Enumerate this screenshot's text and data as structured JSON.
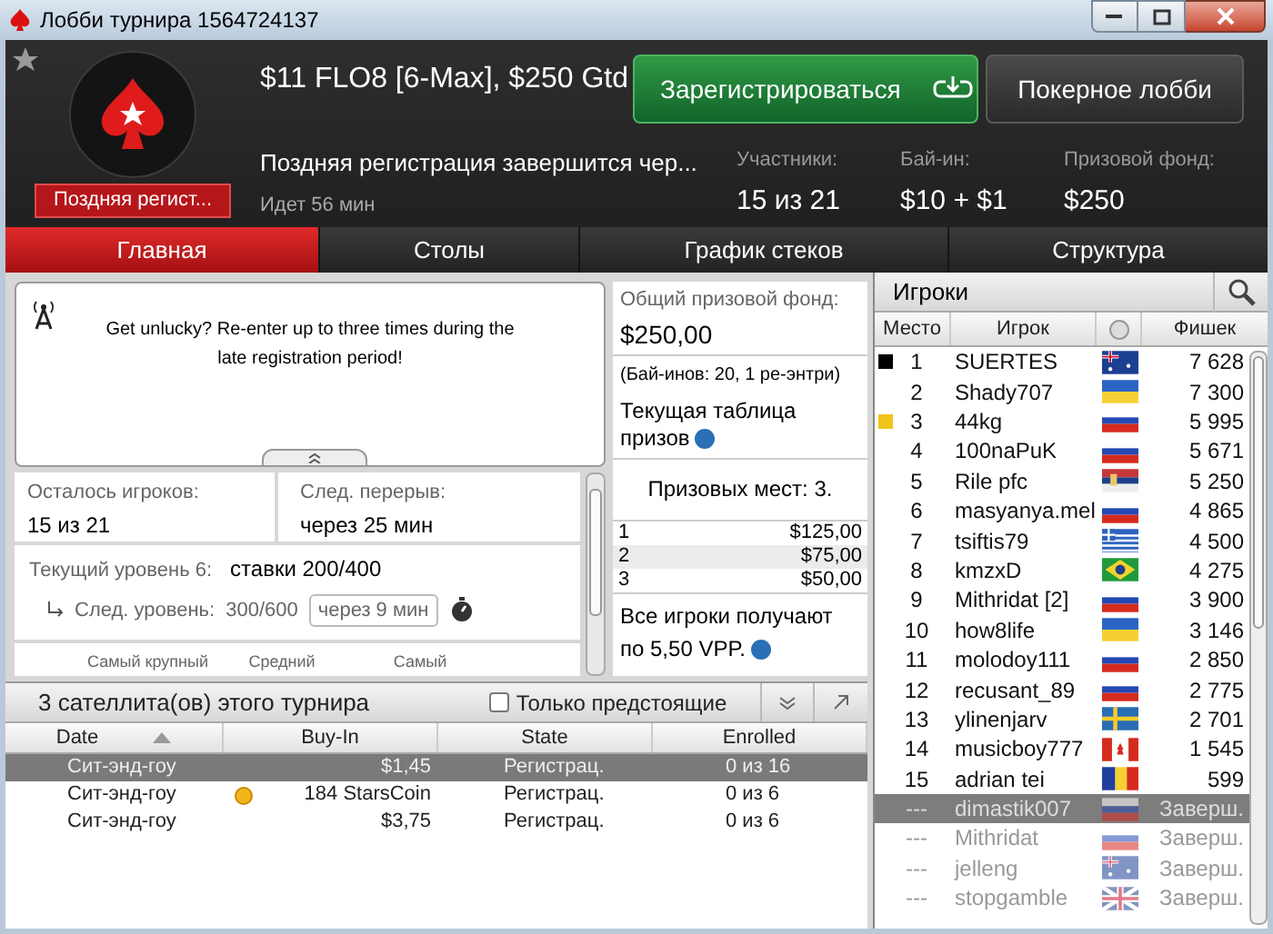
{
  "window": {
    "title": "Лобби турнира 1564724137"
  },
  "header": {
    "tournament_name": "$11 FLO8 [6-Max], $250 Gtd",
    "status_badge": "Поздняя регист...",
    "register_button": "Зарегистрироваться",
    "lobby_button": "Покерное лобби",
    "late_reg_notice": "Поздняя регистрация завершится чер...",
    "elapsed": "Идет 56 мин",
    "stats": [
      {
        "label": "Участники:",
        "value": "15 из 21"
      },
      {
        "label": "Бай-ин:",
        "value": "$10 + $1"
      },
      {
        "label": "Призовой фонд:",
        "value": "$250"
      }
    ]
  },
  "tabs": [
    {
      "label": "Главная",
      "selected": true
    },
    {
      "label": "Столы",
      "selected": false
    },
    {
      "label": "График стеков",
      "selected": false
    },
    {
      "label": "Структура",
      "selected": false
    }
  ],
  "announcement": "Get unlucky? Re-enter up to three times during the late registration period!",
  "info": {
    "players_left": {
      "label": "Осталось игроков:",
      "value": "15 из 21"
    },
    "next_break": {
      "label": "След. перерыв:",
      "value": "через 25 мин"
    },
    "current_level": {
      "label": "Текущий уровень 6:",
      "value": "ставки 200/400"
    },
    "next_level": {
      "label": "След. уровень:",
      "value": "300/600",
      "timer": "через 9 мин"
    },
    "stack_columns": [
      "Самый крупный",
      "Средний",
      "Самый"
    ]
  },
  "prize_pool": {
    "label": "Общий призовой фонд:",
    "amount": "$250,00",
    "entries": "(Бай-инов: 20, 1 ре-энтри)",
    "table_title": "Текущая таблица призов",
    "places": "Призовых мест: 3.",
    "payouts": [
      {
        "place": "1",
        "amount": "$125,00"
      },
      {
        "place": "2",
        "amount": "$75,00"
      },
      {
        "place": "3",
        "amount": "$50,00"
      }
    ],
    "vpp": "Все игроки получают по 5,50 VPP."
  },
  "players": {
    "title": "Игроки",
    "columns": [
      "Место",
      "Игрок",
      "Фишек"
    ],
    "rows": [
      {
        "place": "1",
        "name": "SUERTES",
        "kind": "au",
        "chips": "7 628",
        "color": "#000000",
        "eliminated": false,
        "selected": false
      },
      {
        "place": "2",
        "name": "Shady707",
        "kind": "ua",
        "chips": "7 300",
        "eliminated": false,
        "selected": false
      },
      {
        "place": "3",
        "name": "44kg",
        "kind": "ru",
        "chips": "5 995",
        "color": "#f0c419",
        "eliminated": false,
        "selected": false
      },
      {
        "place": "4",
        "name": "100naPuK",
        "kind": "ru",
        "chips": "5 671",
        "eliminated": false,
        "selected": false
      },
      {
        "place": "5",
        "name": "Rile pfc",
        "kind": "rs",
        "chips": "5 250",
        "eliminated": false,
        "selected": false
      },
      {
        "place": "6",
        "name": "masyanya.mel",
        "kind": "ru",
        "chips": "4 865",
        "eliminated": false,
        "selected": false
      },
      {
        "place": "7",
        "name": "tsiftis79",
        "kind": "gr",
        "chips": "4 500",
        "eliminated": false,
        "selected": false
      },
      {
        "place": "8",
        "name": "kmzxD",
        "kind": "br",
        "chips": "4 275",
        "eliminated": false,
        "selected": false
      },
      {
        "place": "9",
        "name": "Mithridat [2]",
        "kind": "ru",
        "chips": "3 900",
        "eliminated": false,
        "selected": false
      },
      {
        "place": "10",
        "name": "how8life",
        "kind": "ua",
        "chips": "3 146",
        "eliminated": false,
        "selected": false
      },
      {
        "place": "11",
        "name": "molodoy111",
        "kind": "ru",
        "chips": "2 850",
        "eliminated": false,
        "selected": false
      },
      {
        "place": "12",
        "name": "recusant_89",
        "kind": "ru",
        "chips": "2 775",
        "eliminated": false,
        "selected": false
      },
      {
        "place": "13",
        "name": "ylinenjarv",
        "kind": "se",
        "chips": "2 701",
        "eliminated": false,
        "selected": false
      },
      {
        "place": "14",
        "name": "musicboy777",
        "kind": "ca",
        "chips": "1 545",
        "eliminated": false,
        "selected": false
      },
      {
        "place": "15",
        "name": "adrian tei",
        "kind": "ro",
        "chips": "599",
        "eliminated": false,
        "selected": false
      },
      {
        "place": "---",
        "name": "dimastik007",
        "kind": "ru",
        "chips": "Заверш.",
        "eliminated": true,
        "selected": true
      },
      {
        "place": "---",
        "name": "Mithridat",
        "kind": "ru",
        "chips": "Заверш.",
        "eliminated": true,
        "selected": false
      },
      {
        "place": "---",
        "name": "jelleng",
        "kind": "au",
        "chips": "Заверш.",
        "eliminated": true,
        "selected": false
      },
      {
        "place": "---",
        "name": "stopgamble",
        "kind": "gb",
        "chips": "Заверш.",
        "eliminated": true,
        "selected": false
      }
    ]
  },
  "satellites": {
    "title": "3 сателлита(ов) этого турнира",
    "upcoming_only": {
      "label": "Только предстоящие",
      "checked": false
    },
    "columns": [
      "Date",
      "Buy-In",
      "State",
      "Enrolled"
    ],
    "rows": [
      {
        "date": "Сит-энд-гоу",
        "buy_in": "$1,45",
        "kind": "cash",
        "state": "Регистрац.",
        "enrolled": "0 из 16",
        "selected": true
      },
      {
        "date": "Сит-энд-гоу",
        "buy_in": "184 StarsCoin",
        "kind": "starscoin",
        "state": "Регистрац.",
        "enrolled": "0 из 6",
        "selected": false
      },
      {
        "date": "Сит-энд-гоу",
        "buy_in": "$3,75",
        "kind": "cash",
        "state": "Регистрац.",
        "enrolled": "0 из 6",
        "selected": false
      }
    ]
  }
}
